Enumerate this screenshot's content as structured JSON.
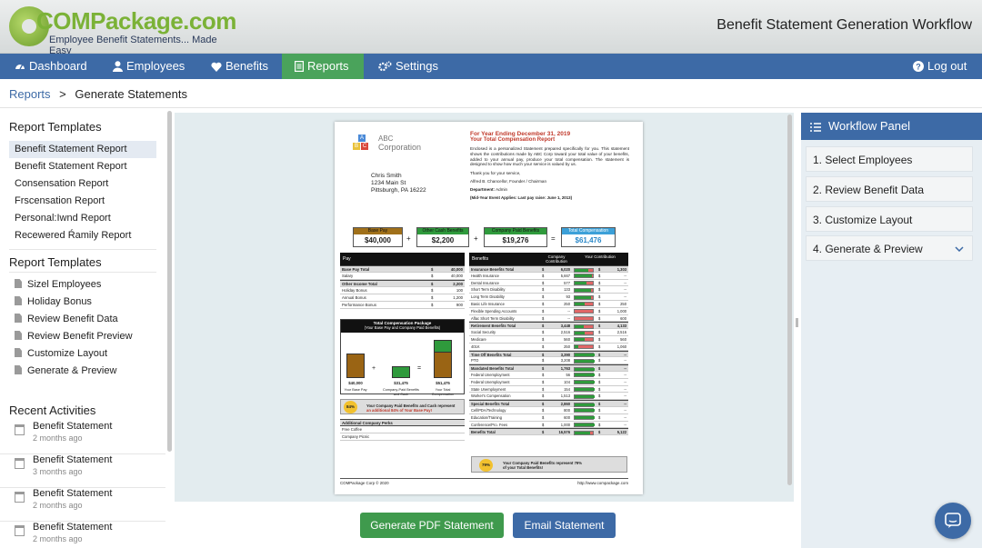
{
  "app": {
    "logo_text": "COMPackage.com",
    "logo_tagline": "Employee Benefit Statements... Made Easy",
    "title": "Benefit Statement Generation Workflow"
  },
  "nav": {
    "items": [
      {
        "label": "Dashboard",
        "icon": "dashboard-icon"
      },
      {
        "label": "Employees",
        "icon": "user-icon"
      },
      {
        "label": "Benefits",
        "icon": "heart-icon"
      },
      {
        "label": "Reports",
        "icon": "document-icon",
        "active": true
      },
      {
        "label": "Settings",
        "icon": "gears-icon"
      }
    ],
    "logout_label": "Log out"
  },
  "breadcrumb": {
    "parent": "Reports",
    "separator": ">",
    "current": "Generate Statements"
  },
  "sidebar": {
    "templates_title": "Report Templates",
    "templates": [
      "Benefit Statement Report",
      "Benefit Statement Report",
      "Consensation Report",
      "Frscensation Report",
      "Personal:Iwnd Report",
      "Recewered Ŕamily Report"
    ],
    "templates2_title": "Report Templates",
    "templates2": [
      "Sizel Employees",
      "Holiday Bonus",
      "Review Benefit Data",
      "Review Benefit Preview",
      "Customize Layout",
      "Generate & Preview"
    ],
    "activities_title": "Recent Activities",
    "activities": [
      {
        "title": "Benefit Statement",
        "time": "2 months ago"
      },
      {
        "title": "Benefit Statement",
        "time": "3 months ago"
      },
      {
        "title": "Benefit Statement",
        "time": "2 months ago"
      },
      {
        "title": "Benefit Statement",
        "time": "2 months ago"
      }
    ]
  },
  "statement": {
    "company_line1": "ABC",
    "company_line2": "Corporation",
    "employee_name": "Chris Smith",
    "address1": "1234 Main St",
    "address2": "Pittsburgh, PA 16222",
    "year_heading": "For Year Ending December 31, 2019",
    "comp_heading": "Your Total Compensation Report",
    "intro": "Enclosed is a personalized Statement prepared specifically for you. This statement shows the contributions made by ABC Corp toward your total value of your benefits, added to your annual pay, produce your total compensation. The statement is designed to show how much your service is valued by us.",
    "thanks": "Thank you for your service,",
    "signer": "Alfred B. Chancellor, Founder / Chairman",
    "department_label": "Department:",
    "department": "Admin",
    "event_note": "(Mid-Year Event Applies: Last pay raise: June 1, 2013)",
    "summary": [
      {
        "label": "Base Pay",
        "value": "$40,000",
        "color": "#a0701a"
      },
      {
        "label": "Other Cash Benefits",
        "value": "$2,200",
        "color": "#2f9a3c"
      },
      {
        "label": "Company Paid Benefits",
        "value": "$19,276",
        "color": "#2f9a3c"
      },
      {
        "label": "Total Compensation",
        "value": "$61,476",
        "color": "#3ca0d8"
      }
    ],
    "ops": [
      "+",
      "+",
      "="
    ],
    "pay_header": "Pay",
    "pay_rows": [
      {
        "label": "Base Pay Total",
        "sym": "$",
        "value": "40,000",
        "bold": true
      },
      {
        "label": "Salary",
        "sym": "$",
        "value": "40,000"
      },
      {
        "label": "Other Income Total",
        "sym": "$",
        "value": "2,200",
        "bold": true
      },
      {
        "label": "Holiday Bonus",
        "sym": "$",
        "value": "100"
      },
      {
        "label": "Annual Bonus",
        "sym": "$",
        "value": "1,200"
      },
      {
        "label": "Performance Bonus",
        "sym": "$",
        "value": "900"
      }
    ],
    "pkg_title": "Total Compensation Package",
    "pkg_sub": "(Your Base Pay and Company Paid Benefits)",
    "pkg_bars": [
      {
        "value": "$40,000",
        "label": "Your Base Pay",
        "ratio": 0.65,
        "color": "#9a6414"
      },
      {
        "value": "$31,475",
        "label": "Company-Paid Benefits and Cash",
        "ratio": 0.32,
        "color": "#2f9a3c"
      },
      {
        "value": "$51,475",
        "label": "Your Total Compensation",
        "ratio": 1.0,
        "color": "#9a6414"
      }
    ],
    "pkg_ops": [
      "+",
      "="
    ],
    "callout1_pct": "84%",
    "callout1_text": "Your Company Paid Benefits and Cash represent",
    "callout1_text2": "an additional 84% of Your Base Pay!",
    "perks_header": "Additional Company Perks",
    "perks": [
      "Free Coffee",
      "Company Picnic"
    ],
    "benefits_header": "Benefits",
    "col_company": "Company Contribution",
    "col_your": "Your Contribution",
    "benefit_rows": [
      {
        "label": "Insurance Benefits Total",
        "c": "6,020",
        "y": "1,303",
        "bold": true,
        "g": 0.7
      },
      {
        "label": "Health Insurance",
        "c": "5,667",
        "y": "--",
        "g": 0.85
      },
      {
        "label": "Dental Insurance",
        "c": "577",
        "y": "--",
        "g": 0.6
      },
      {
        "label": "Short Term Disability",
        "c": "133",
        "y": "--",
        "g": 0.8
      },
      {
        "label": "Long Term Disability",
        "c": "93",
        "y": "--",
        "g": 0.8
      },
      {
        "label": "Basic Life Insurance",
        "c": "250",
        "y": "250",
        "g": 0.5
      },
      {
        "label": "Flexible Spending Accounts",
        "c": "--",
        "y": "1,000",
        "g": 0.0
      },
      {
        "label": "Aflac Short Term Disability",
        "c": "--",
        "y": "600",
        "g": 0.0
      },
      {
        "label": "Retirement Benefits Total",
        "c": "3,448",
        "y": "4,133",
        "bold": true,
        "g": 0.45
      },
      {
        "label": "Social Security",
        "c": "2,516",
        "y": "2,516",
        "g": 0.5
      },
      {
        "label": "Medicare",
        "c": "560",
        "y": "560",
        "g": 0.5
      },
      {
        "label": "401K",
        "c": "250",
        "y": "1,060",
        "g": 0.2
      },
      {
        "label": "Time Off Benefits Total",
        "c": "3,390",
        "y": "--",
        "bold": true,
        "g": 1.0
      },
      {
        "label": "PTO",
        "c": "3,208",
        "y": "--",
        "g": 1.0
      },
      {
        "label": "Mandated Benefits Total",
        "c": "1,763",
        "y": "--",
        "bold": true,
        "g": 1.0
      },
      {
        "label": "Federal Unemployment",
        "c": "56",
        "y": "--",
        "g": 1.0
      },
      {
        "label": "Federal Unemployment",
        "c": "104",
        "y": "--",
        "g": 1.0
      },
      {
        "label": "State Unemployment",
        "c": "154",
        "y": "--",
        "g": 1.0
      },
      {
        "label": "Worker's Compensation",
        "c": "1,513",
        "y": "--",
        "g": 1.0
      },
      {
        "label": "Special Benefits Total",
        "c": "2,860",
        "y": "--",
        "bold": true,
        "g": 1.0
      },
      {
        "label": "Cell/PDA/Technology",
        "c": "800",
        "y": "--",
        "g": 1.0
      },
      {
        "label": "Education/Training",
        "c": "600",
        "y": "--",
        "g": 1.0
      },
      {
        "label": "Conference/Pro. Fees",
        "c": "1,000",
        "y": "--",
        "g": 1.0
      },
      {
        "label": "Benefits Total",
        "c": "16,576",
        "y": "5,122",
        "bold": true,
        "g": 0.75
      }
    ],
    "callout2_pct": "79%",
    "callout2_text": "Your Company Paid Benefits represent 79%",
    "callout2_text2": "of your Total Benefits!",
    "footer_left": "COMPackage Corp © 2020",
    "footer_right": "http://www.compackage.com"
  },
  "actions": {
    "pdf_label": "Generate PDF Statement",
    "email_label": "Email Statement"
  },
  "workflow": {
    "title": "Workflow Panel",
    "steps": [
      "1. Select Employees",
      "2. Review Benefit Data",
      "3. Customize Layout",
      "4. Generate & Preview"
    ]
  },
  "colors": {
    "nav": "#3d6aa6",
    "active": "#4aa35b",
    "primary_btn": "#3f9a4d",
    "secondary_btn": "#3d6aa6"
  }
}
